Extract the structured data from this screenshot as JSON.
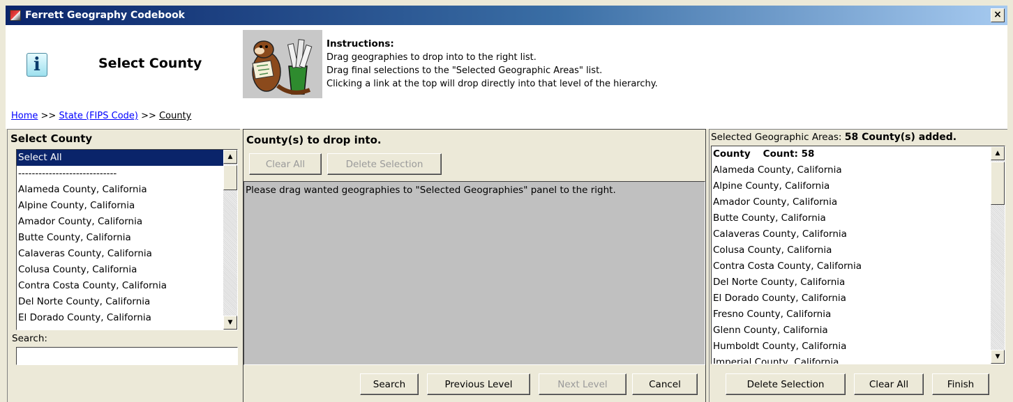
{
  "window": {
    "title": "Ferrett Geography Codebook",
    "close_glyph": "×"
  },
  "header": {
    "title": "Select County",
    "icon": "info-icon",
    "instructions": {
      "title": "Instructions:",
      "lines": [
        "Drag geographies to drop into to the right list.",
        "Drag final selections to the \"Selected Geographic Areas\" list.",
        "Clicking a link at the top will drop directly into that level of the hierarchy."
      ]
    }
  },
  "breadcrumb": {
    "home": "Home",
    "sep1": ">>",
    "state": "State (FIPS Code)",
    "sep2": ">>",
    "county": "County"
  },
  "left_panel": {
    "heading": "Select County",
    "items": [
      "Select All",
      "-----------------------------",
      "Alameda County, California",
      "Alpine County, California",
      "Amador County, California",
      "Butte County, California",
      "Calaveras County, California",
      "Colusa County, California",
      "Contra Costa County, California",
      "Del Norte County, California",
      "El Dorado County, California"
    ],
    "selected_index": 0,
    "search_label": "Search:",
    "search_value": ""
  },
  "middle_panel": {
    "heading": "County(s) to drop into.",
    "clear_all": "Clear All",
    "delete_selection": "Delete Selection",
    "message": "Please drag wanted geographies to \"Selected Geographies\" panel to the right."
  },
  "right_panel": {
    "heading_prefix": "Selected Geographic Areas:",
    "heading_count": "58 County(s) added.",
    "column_label": "County",
    "count_label": "Count: 58",
    "items": [
      "Alameda County, California",
      "Alpine County, California",
      "Amador County, California",
      "Butte County, California",
      "Calaveras County, California",
      "Colusa County, California",
      "Contra Costa County, California",
      "Del Norte County, California",
      "El Dorado County, California",
      "Fresno County, California",
      "Glenn County, California",
      "Humboldt County, California",
      "Imperial County, California"
    ]
  },
  "footer": {
    "search": "Search",
    "previous_level": "Previous Level",
    "next_level": "Next Level",
    "cancel": "Cancel",
    "delete_selection": "Delete Selection",
    "clear_all": "Clear All",
    "finish": "Finish"
  },
  "colors": {
    "title_bar": "#0a246a",
    "selection": "#0a246a",
    "link": "#0000ff",
    "face": "#ece9d8",
    "drop_area": "#c0c0c0"
  }
}
